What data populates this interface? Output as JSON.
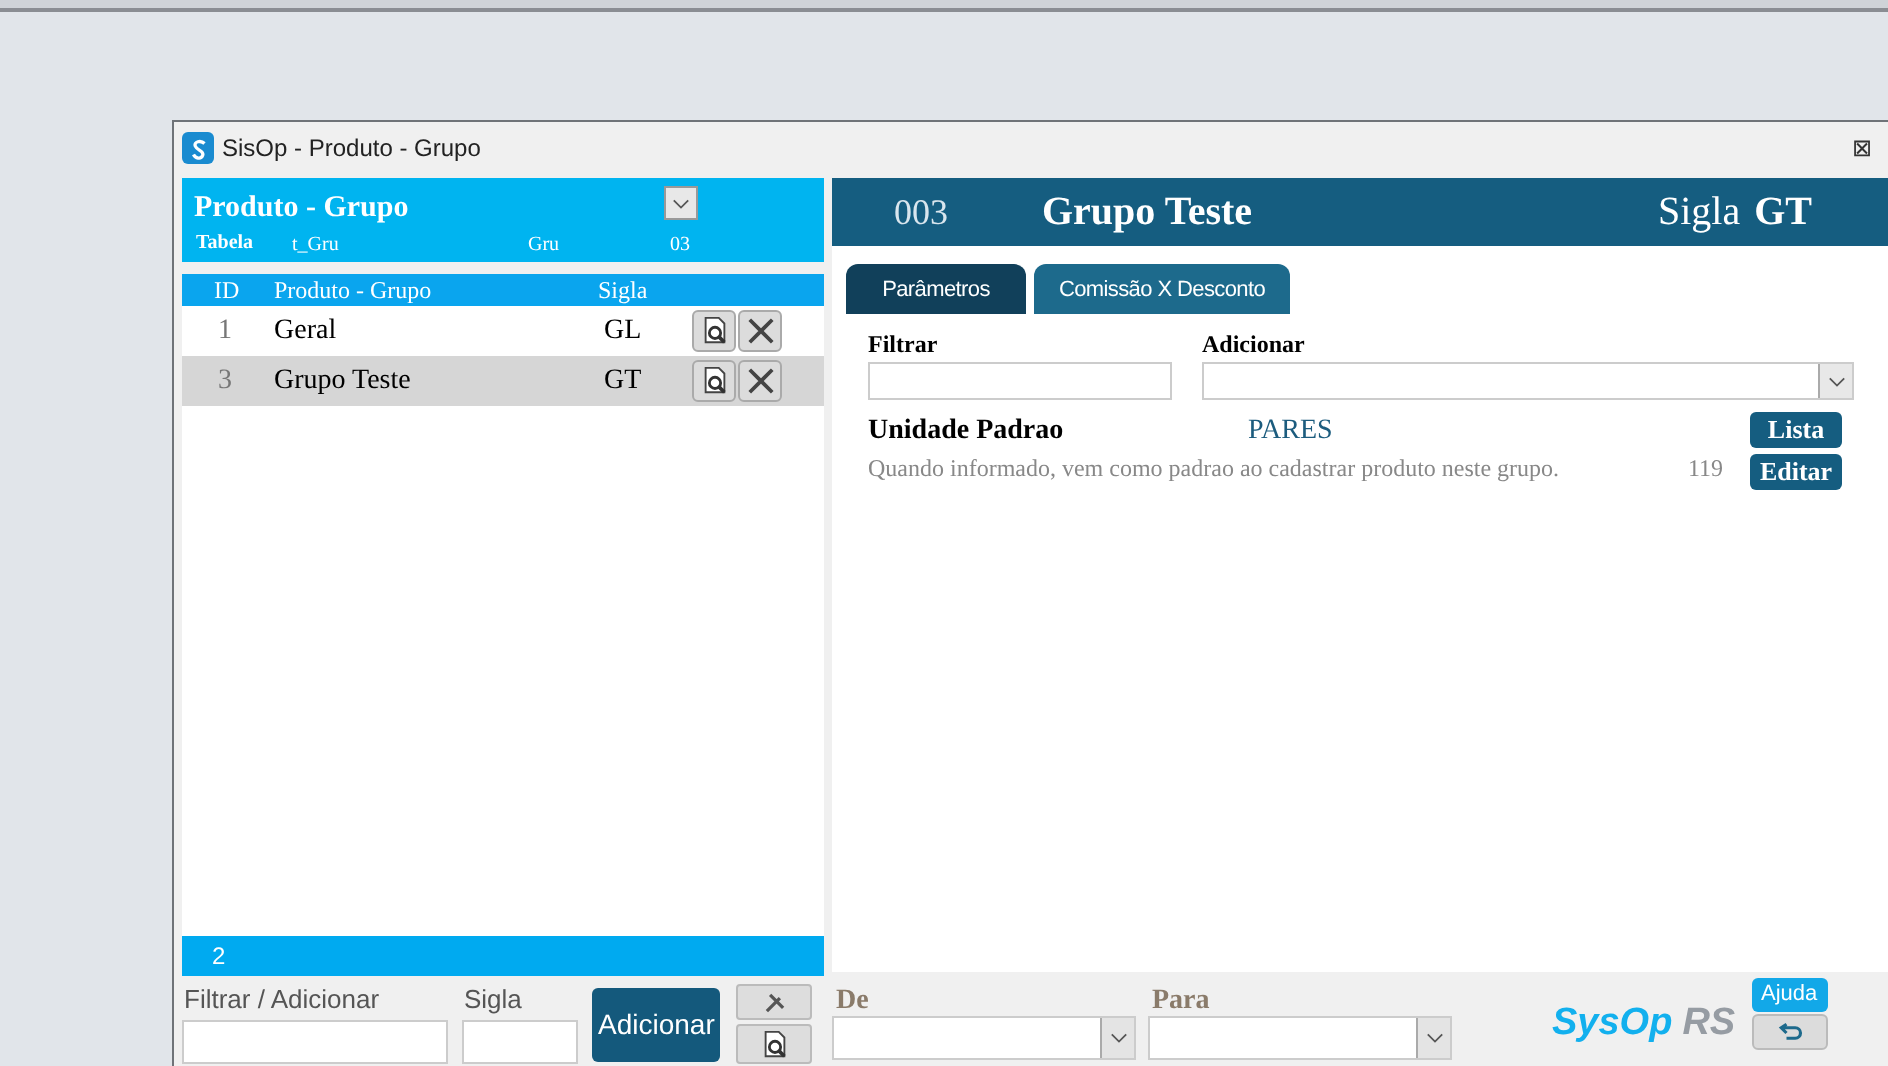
{
  "window": {
    "title": "SisOp - Produto - Grupo",
    "close": "⊠"
  },
  "left_panel": {
    "title": "Produto - Grupo",
    "table_label": "Tabela",
    "table_name": "t_Gru",
    "code_name": "Gru",
    "code": "03",
    "columns": [
      "ID",
      "Produto - Grupo",
      "Sigla"
    ],
    "rows": [
      {
        "id": "1",
        "name": "Geral",
        "sigla": "GL",
        "selected": false
      },
      {
        "id": "3",
        "name": "Grupo Teste",
        "sigla": "GT",
        "selected": true
      }
    ],
    "count": "2"
  },
  "bottom_left": {
    "filter_label": "Filtrar / Adicionar",
    "sigla_label": "Sigla",
    "add_button": "Adicionar"
  },
  "detail": {
    "code": "003",
    "name": "Grupo Teste",
    "sigla_label": "Sigla",
    "sigla": "GT"
  },
  "tabs": [
    {
      "label": "Parâmetros",
      "selected": true
    },
    {
      "label": "Comissão X Desconto",
      "selected": false
    }
  ],
  "filter_label": "Filtrar",
  "add_label": "Adicionar",
  "parameter": {
    "name": "Unidade Padrao",
    "value": "PARES",
    "description": "Quando informado, vem como padrao ao cadastrar produto neste grupo.",
    "number": "119",
    "list_button": "Lista",
    "edit_button": "Editar"
  },
  "bottom_right": {
    "from_label": "De",
    "to_label": "Para",
    "logo_main": "SysOp",
    "logo_suffix": "RS",
    "help_button": "Ajuda"
  }
}
